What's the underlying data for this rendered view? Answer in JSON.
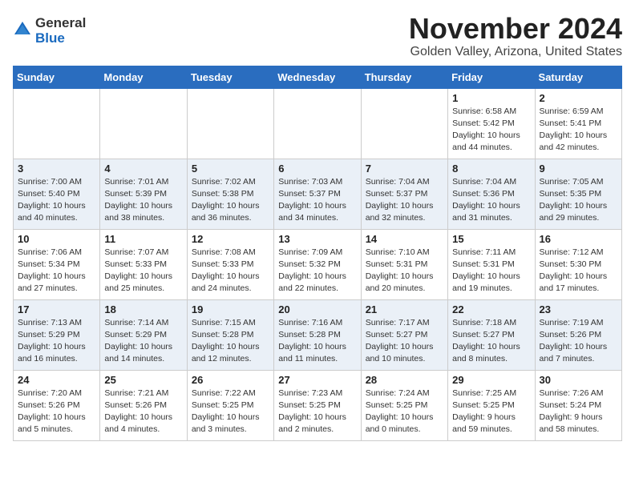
{
  "logo": {
    "general": "General",
    "blue": "Blue"
  },
  "title": "November 2024",
  "location": "Golden Valley, Arizona, United States",
  "days_of_week": [
    "Sunday",
    "Monday",
    "Tuesday",
    "Wednesday",
    "Thursday",
    "Friday",
    "Saturday"
  ],
  "weeks": [
    [
      {
        "day": "",
        "info": ""
      },
      {
        "day": "",
        "info": ""
      },
      {
        "day": "",
        "info": ""
      },
      {
        "day": "",
        "info": ""
      },
      {
        "day": "",
        "info": ""
      },
      {
        "day": "1",
        "info": "Sunrise: 6:58 AM\nSunset: 5:42 PM\nDaylight: 10 hours\nand 44 minutes."
      },
      {
        "day": "2",
        "info": "Sunrise: 6:59 AM\nSunset: 5:41 PM\nDaylight: 10 hours\nand 42 minutes."
      }
    ],
    [
      {
        "day": "3",
        "info": "Sunrise: 7:00 AM\nSunset: 5:40 PM\nDaylight: 10 hours\nand 40 minutes."
      },
      {
        "day": "4",
        "info": "Sunrise: 7:01 AM\nSunset: 5:39 PM\nDaylight: 10 hours\nand 38 minutes."
      },
      {
        "day": "5",
        "info": "Sunrise: 7:02 AM\nSunset: 5:38 PM\nDaylight: 10 hours\nand 36 minutes."
      },
      {
        "day": "6",
        "info": "Sunrise: 7:03 AM\nSunset: 5:37 PM\nDaylight: 10 hours\nand 34 minutes."
      },
      {
        "day": "7",
        "info": "Sunrise: 7:04 AM\nSunset: 5:37 PM\nDaylight: 10 hours\nand 32 minutes."
      },
      {
        "day": "8",
        "info": "Sunrise: 7:04 AM\nSunset: 5:36 PM\nDaylight: 10 hours\nand 31 minutes."
      },
      {
        "day": "9",
        "info": "Sunrise: 7:05 AM\nSunset: 5:35 PM\nDaylight: 10 hours\nand 29 minutes."
      }
    ],
    [
      {
        "day": "10",
        "info": "Sunrise: 7:06 AM\nSunset: 5:34 PM\nDaylight: 10 hours\nand 27 minutes."
      },
      {
        "day": "11",
        "info": "Sunrise: 7:07 AM\nSunset: 5:33 PM\nDaylight: 10 hours\nand 25 minutes."
      },
      {
        "day": "12",
        "info": "Sunrise: 7:08 AM\nSunset: 5:33 PM\nDaylight: 10 hours\nand 24 minutes."
      },
      {
        "day": "13",
        "info": "Sunrise: 7:09 AM\nSunset: 5:32 PM\nDaylight: 10 hours\nand 22 minutes."
      },
      {
        "day": "14",
        "info": "Sunrise: 7:10 AM\nSunset: 5:31 PM\nDaylight: 10 hours\nand 20 minutes."
      },
      {
        "day": "15",
        "info": "Sunrise: 7:11 AM\nSunset: 5:31 PM\nDaylight: 10 hours\nand 19 minutes."
      },
      {
        "day": "16",
        "info": "Sunrise: 7:12 AM\nSunset: 5:30 PM\nDaylight: 10 hours\nand 17 minutes."
      }
    ],
    [
      {
        "day": "17",
        "info": "Sunrise: 7:13 AM\nSunset: 5:29 PM\nDaylight: 10 hours\nand 16 minutes."
      },
      {
        "day": "18",
        "info": "Sunrise: 7:14 AM\nSunset: 5:29 PM\nDaylight: 10 hours\nand 14 minutes."
      },
      {
        "day": "19",
        "info": "Sunrise: 7:15 AM\nSunset: 5:28 PM\nDaylight: 10 hours\nand 12 minutes."
      },
      {
        "day": "20",
        "info": "Sunrise: 7:16 AM\nSunset: 5:28 PM\nDaylight: 10 hours\nand 11 minutes."
      },
      {
        "day": "21",
        "info": "Sunrise: 7:17 AM\nSunset: 5:27 PM\nDaylight: 10 hours\nand 10 minutes."
      },
      {
        "day": "22",
        "info": "Sunrise: 7:18 AM\nSunset: 5:27 PM\nDaylight: 10 hours\nand 8 minutes."
      },
      {
        "day": "23",
        "info": "Sunrise: 7:19 AM\nSunset: 5:26 PM\nDaylight: 10 hours\nand 7 minutes."
      }
    ],
    [
      {
        "day": "24",
        "info": "Sunrise: 7:20 AM\nSunset: 5:26 PM\nDaylight: 10 hours\nand 5 minutes."
      },
      {
        "day": "25",
        "info": "Sunrise: 7:21 AM\nSunset: 5:26 PM\nDaylight: 10 hours\nand 4 minutes."
      },
      {
        "day": "26",
        "info": "Sunrise: 7:22 AM\nSunset: 5:25 PM\nDaylight: 10 hours\nand 3 minutes."
      },
      {
        "day": "27",
        "info": "Sunrise: 7:23 AM\nSunset: 5:25 PM\nDaylight: 10 hours\nand 2 minutes."
      },
      {
        "day": "28",
        "info": "Sunrise: 7:24 AM\nSunset: 5:25 PM\nDaylight: 10 hours\nand 0 minutes."
      },
      {
        "day": "29",
        "info": "Sunrise: 7:25 AM\nSunset: 5:25 PM\nDaylight: 9 hours\nand 59 minutes."
      },
      {
        "day": "30",
        "info": "Sunrise: 7:26 AM\nSunset: 5:24 PM\nDaylight: 9 hours\nand 58 minutes."
      }
    ]
  ]
}
